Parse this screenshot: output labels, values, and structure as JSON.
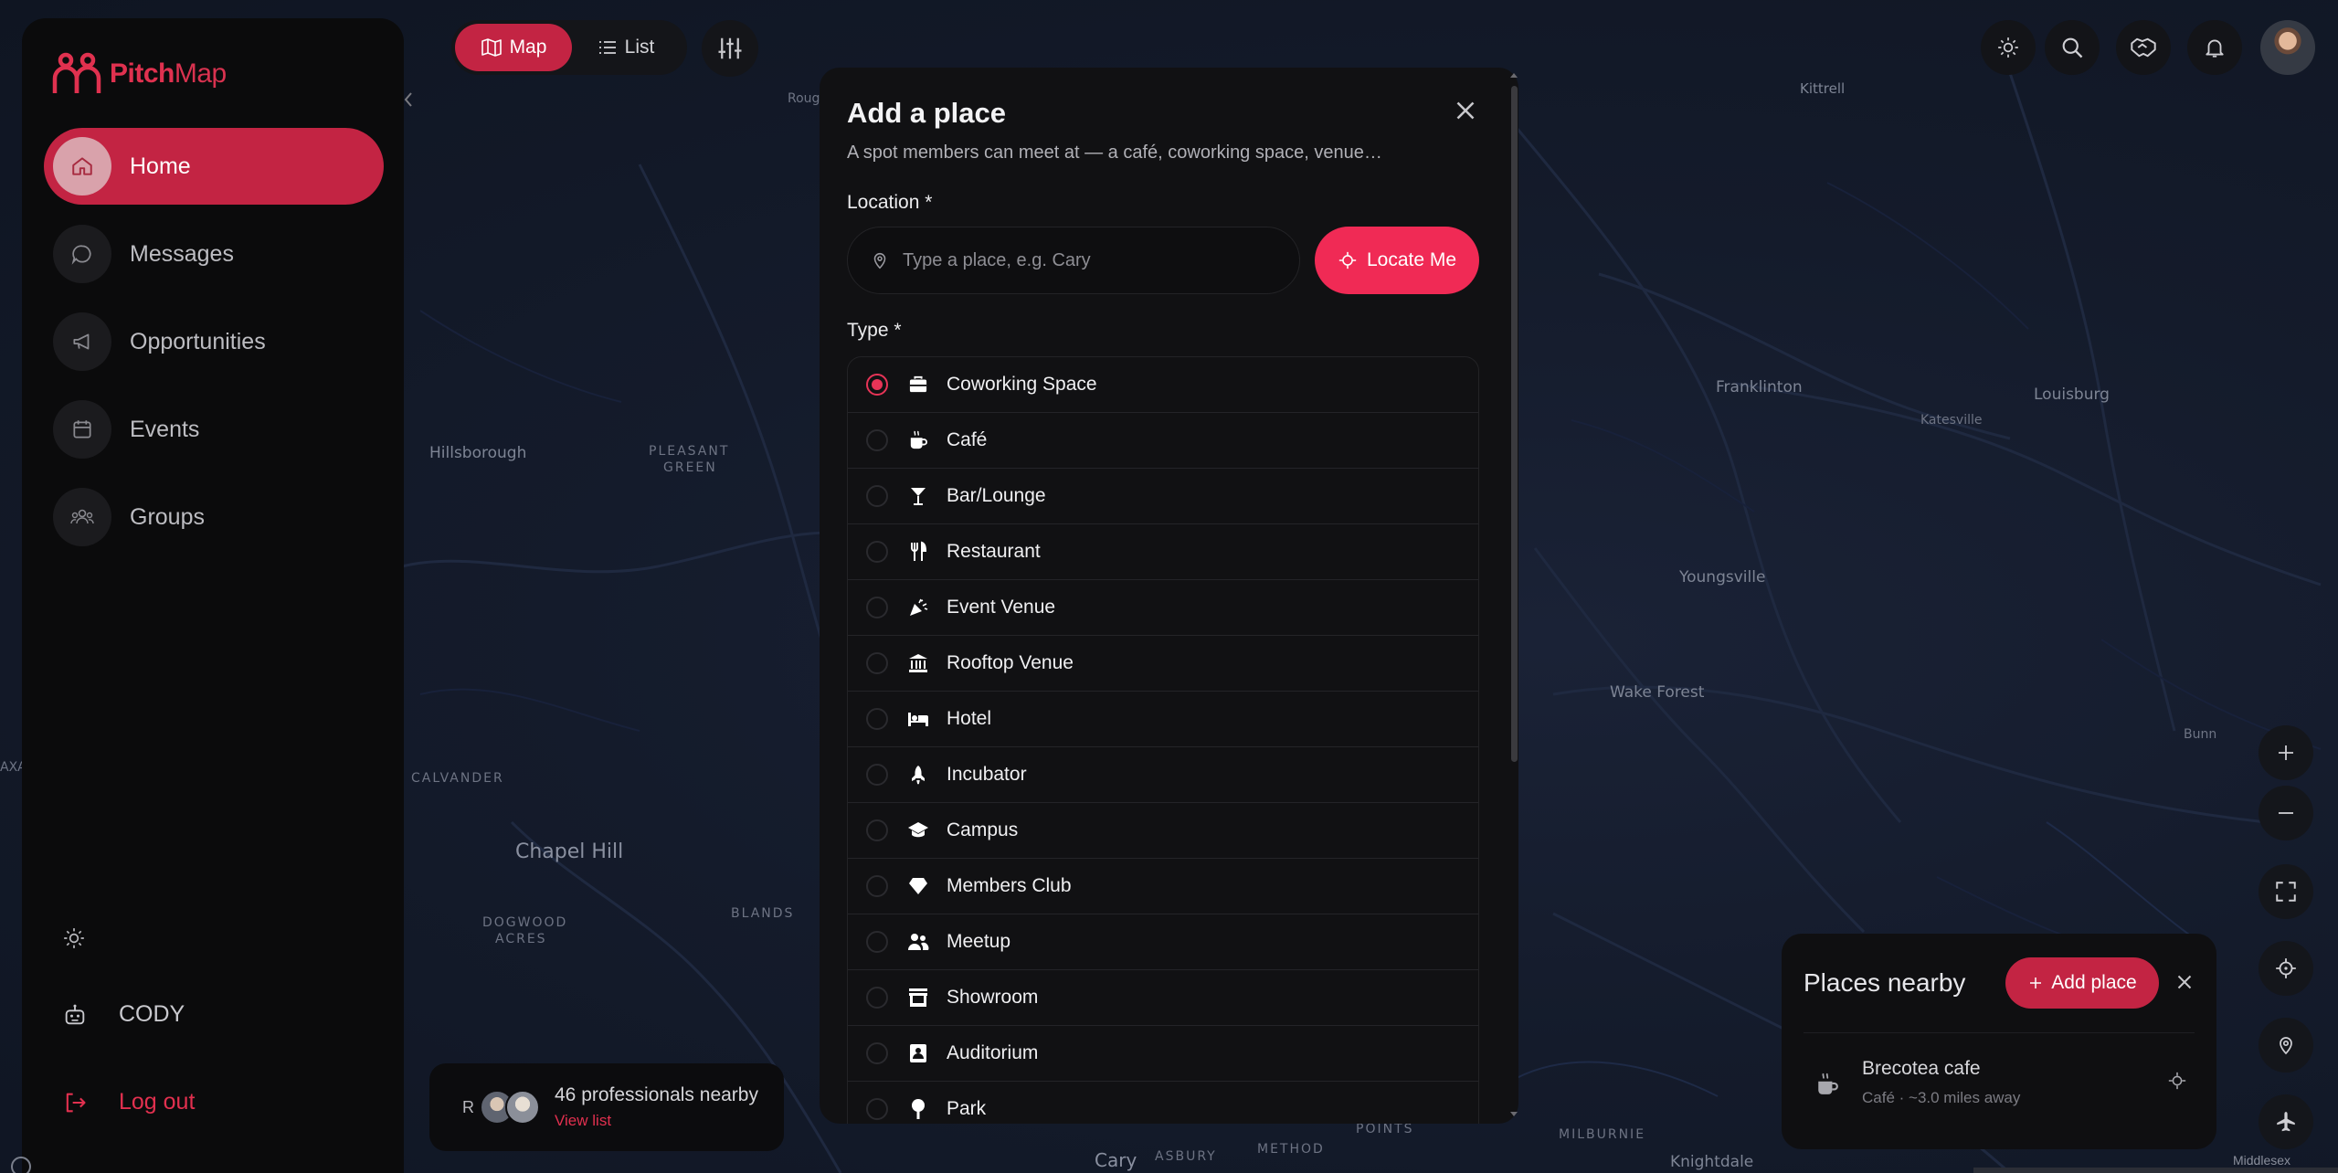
{
  "app": {
    "brand_a": "Pitch",
    "brand_b": "Map"
  },
  "sidebar": {
    "items": [
      {
        "label": "Home",
        "icon": "home-icon",
        "active": true
      },
      {
        "label": "Messages",
        "icon": "chat-icon",
        "active": false
      },
      {
        "label": "Opportunities",
        "icon": "megaphone-icon",
        "active": false
      },
      {
        "label": "Events",
        "icon": "calendar-icon",
        "active": false
      },
      {
        "label": "Groups",
        "icon": "users-icon",
        "active": false
      }
    ],
    "assistant_label": "CODY",
    "logout_label": "Log out"
  },
  "view_toggle": {
    "map_label": "Map",
    "list_label": "List",
    "active": "Map"
  },
  "modal": {
    "title": "Add a place",
    "subtitle": "A spot members can meet at — a café, coworking space, venue…",
    "location_label": "Location *",
    "location_placeholder": "Type a place, e.g. Cary",
    "locate_label": "Locate Me",
    "type_label": "Type *",
    "types": [
      {
        "label": "Coworking Space",
        "icon": "briefcase-icon",
        "selected": true
      },
      {
        "label": "Café",
        "icon": "coffee-cup-icon",
        "selected": false
      },
      {
        "label": "Bar/Lounge",
        "icon": "cocktail-icon",
        "selected": false
      },
      {
        "label": "Restaurant",
        "icon": "utensils-icon",
        "selected": false
      },
      {
        "label": "Event Venue",
        "icon": "party-popper-icon",
        "selected": false
      },
      {
        "label": "Rooftop Venue",
        "icon": "landmark-icon",
        "selected": false
      },
      {
        "label": "Hotel",
        "icon": "bed-icon",
        "selected": false
      },
      {
        "label": "Incubator",
        "icon": "rocket-icon",
        "selected": false
      },
      {
        "label": "Campus",
        "icon": "graduation-cap-icon",
        "selected": false
      },
      {
        "label": "Members Club",
        "icon": "diamond-icon",
        "selected": false
      },
      {
        "label": "Meetup",
        "icon": "people-icon",
        "selected": false
      },
      {
        "label": "Showroom",
        "icon": "storefront-icon",
        "selected": false
      },
      {
        "label": "Auditorium",
        "icon": "id-card-icon",
        "selected": false
      },
      {
        "label": "Park",
        "icon": "tree-icon",
        "selected": false
      }
    ]
  },
  "professionals": {
    "initial": "R",
    "count_text": "46 professionals nearby",
    "view_label": "View list"
  },
  "places_nearby": {
    "title": "Places nearby",
    "add_label": "Add place",
    "items": [
      {
        "name": "Brecotea cafe",
        "meta": "Café · ~3.0 miles away"
      }
    ]
  },
  "map_labels": [
    "Kittrell",
    "Franklinton",
    "Louisburg",
    "Katesville",
    "Hillsborough",
    "PLEASANT",
    "GREEN",
    "Youngsville",
    "Wake Forest",
    "Bunn",
    "CALVANDER",
    "Chapel Hill",
    "DOGWOOD",
    "ACRES",
    "BLANDS",
    "Cary",
    "ASBURY",
    "METHOD",
    "POINTS",
    "MILBURNIE",
    "Knightdale",
    "Roug",
    "AXA"
  ],
  "attribution": "Middlesex",
  "colors": {
    "accent": "#c32443",
    "accent_bright": "#f02a55",
    "sidebar_bg": "#0b0b0c",
    "map_bg": "#141b2b"
  }
}
